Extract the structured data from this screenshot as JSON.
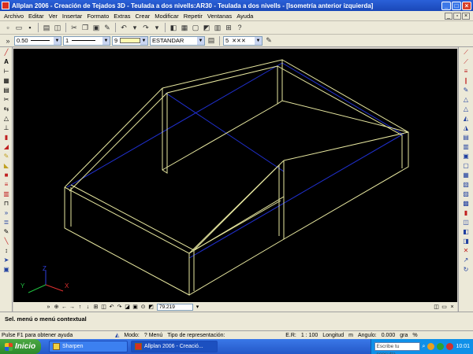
{
  "window": {
    "title": "Allplan 2006 - Creación de Tejados 3D - Teulada a dos nivells:AR30 - Teulada a dos nivells - [Isometría anterior izquierda]"
  },
  "menu": {
    "items": [
      "Archivo",
      "Editar",
      "Ver",
      "Insertar",
      "Formato",
      "Extras",
      "Crear",
      "Modificar",
      "Repetir",
      "Ventanas",
      "Ayuda"
    ]
  },
  "format_bar": {
    "pen_value": "0.50",
    "line_value": "1",
    "color_value": "9",
    "layer_value": "ESTANDAR",
    "pattern_value": "5"
  },
  "viewbar": {
    "zoom_value": "79.219"
  },
  "prompt": {
    "text": "Sel. menú o menú contextual"
  },
  "status": {
    "help": "Pulse F1 para obtener ayuda",
    "mode": "Modo:",
    "mode_value": "? Menú",
    "repr": "Tipo de representación:",
    "scale_label": "E.R:",
    "scale_value": "1 : 100",
    "length_label": "Longitud",
    "length_unit": "m",
    "angle_label": "Angulo:",
    "angle_value": "0.000",
    "angle_unit": "gra",
    "percent": "%"
  },
  "taskbar": {
    "start": "Inicio",
    "tasks": [
      "Sharpen",
      "Allplan 2006 - Creació..."
    ],
    "search_placeholder": "Escribe tu consulta",
    "clock": "10:01"
  },
  "axes": {
    "x": "X",
    "y": "Y",
    "z": "Z"
  },
  "colors": {
    "wire": "#e8e8a0",
    "hidden": "#2030d0",
    "axis_x": "#e03030",
    "axis_y": "#20c040",
    "axis_z": "#3040e0"
  }
}
